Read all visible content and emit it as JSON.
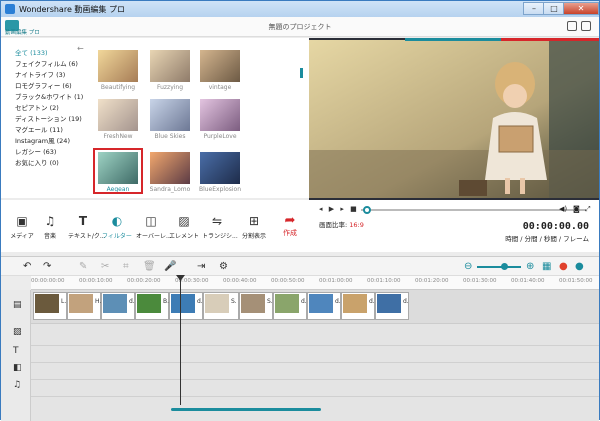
{
  "window": {
    "title": "Wondershare 動画編集 プロ"
  },
  "header": {
    "logo_text": "動画編集 プロ",
    "project_title": "無題のプロジェクト"
  },
  "sidebar": {
    "categories": [
      {
        "label": "全て (133)",
        "selected": true
      },
      {
        "label": "フェイクフィルム (6)"
      },
      {
        "label": "ナイトライフ (3)"
      },
      {
        "label": "ロモグラフィー (6)"
      },
      {
        "label": "ブラック&ホワイト (1)"
      },
      {
        "label": "セピアトン (2)"
      },
      {
        "label": "ディストーション (19)"
      },
      {
        "label": "マグエール (11)"
      },
      {
        "label": "Instagram風 (24)"
      },
      {
        "label": "レガシー (63)"
      },
      {
        "label": "お気に入り (0)"
      }
    ]
  },
  "filters": [
    {
      "name": "Beautifying"
    },
    {
      "name": "Fuzzying"
    },
    {
      "name": "vintage"
    },
    {
      "name": "FreshNew"
    },
    {
      "name": "Blue Skies"
    },
    {
      "name": "PurpleLove"
    },
    {
      "name": "Aegean",
      "selected": true
    },
    {
      "name": "Sandra_Lomo"
    },
    {
      "name": "BlueExplosion"
    }
  ],
  "toolbar": {
    "tools": [
      {
        "label": "メディア",
        "icon": "media-icon"
      },
      {
        "label": "音楽",
        "icon": "music-icon"
      },
      {
        "label": "テキスト/ク...",
        "icon": "text-icon"
      },
      {
        "label": "フィルター",
        "icon": "filter-icon",
        "active": true
      },
      {
        "label": "オーバーレ...",
        "icon": "overlay-icon"
      },
      {
        "label": "エレメント",
        "icon": "element-icon"
      },
      {
        "label": "トランジシ...",
        "icon": "transition-icon"
      },
      {
        "label": "分割表示",
        "icon": "split-screen-icon"
      }
    ],
    "make_label": "作成"
  },
  "player": {
    "aspect_label": "画面比率:",
    "aspect_value": "16:9",
    "timecode": "00:00:00.00",
    "timecode_format": "時間 / 分間 / 秒間 / フレーム",
    "seek_fraction": 0.0
  },
  "timeline": {
    "ruler": [
      "00:00:00:00",
      "00:00:10:00",
      "00:00:20:00",
      "00:00:30:00",
      "00:00:40:00",
      "00:00:50:00",
      "00:01:00:00",
      "00:01:10:00",
      "00:01:20:00",
      "00:01:30:00",
      "00:01:40:00",
      "00:01:50:00"
    ],
    "clips": [
      {
        "label": "L."
      },
      {
        "label": "H."
      },
      {
        "label": "d."
      },
      {
        "label": "B."
      },
      {
        "label": "d."
      },
      {
        "label": "S."
      },
      {
        "label": "S."
      },
      {
        "label": "d."
      },
      {
        "label": "d."
      },
      {
        "label": "d."
      },
      {
        "label": "d."
      }
    ]
  },
  "colors": {
    "accent": "#1b8c9d",
    "highlight": "#d6262a"
  }
}
